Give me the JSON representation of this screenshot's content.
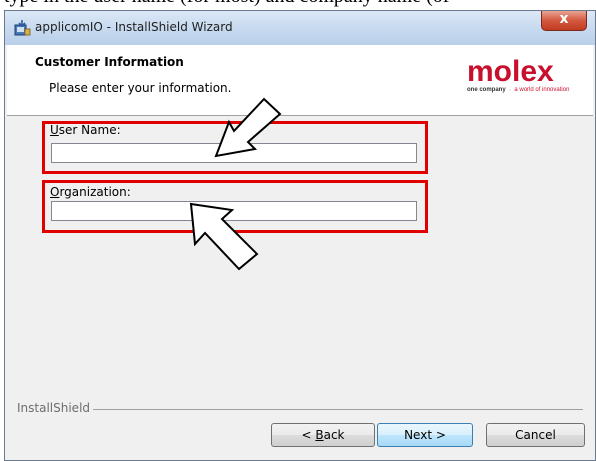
{
  "caption_fragment": "type in the user name (for most) and company name (of",
  "window": {
    "title": "applicomIO - InstallShield Wizard",
    "close_symbol": "x"
  },
  "banner": {
    "title": "Customer Information",
    "subtitle": "Please enter your information.",
    "logo": {
      "word": "molex",
      "tagline_a": "one company",
      "tagline_b": "a world of innovation",
      "brand_color": "#c8102e"
    }
  },
  "form": {
    "user_name": {
      "label_hotkey": "U",
      "label_rest": "ser Name:",
      "value": ""
    },
    "organization": {
      "label_hotkey": "O",
      "label_rest": "rganization:",
      "value": ""
    }
  },
  "annotations": {
    "highlight_color": "#e00000",
    "arrow_count": 2
  },
  "footer": {
    "brand": "InstallShield",
    "back_prefix": "< ",
    "back_hotkey": "B",
    "back_rest": "ack",
    "next_label": "Next >",
    "cancel_label": "Cancel"
  }
}
